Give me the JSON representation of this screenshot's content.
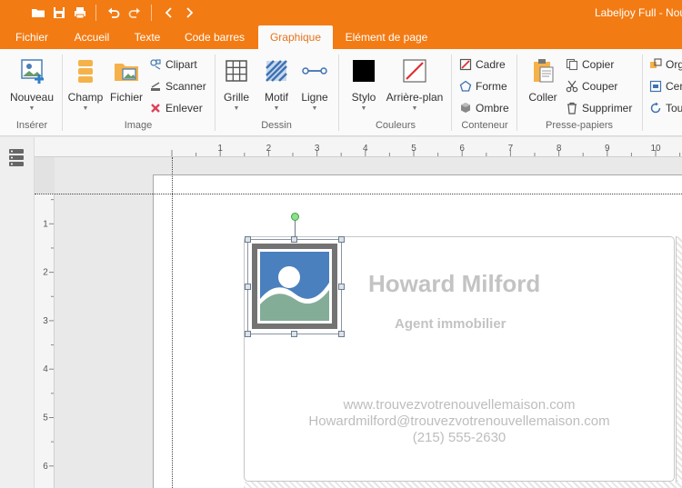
{
  "window": {
    "title": "Labeljoy Full - Nou"
  },
  "tabs": [
    {
      "label": "Fichier"
    },
    {
      "label": "Accueil"
    },
    {
      "label": "Texte"
    },
    {
      "label": "Code barres"
    },
    {
      "label": "Graphique"
    },
    {
      "label": "Elément de page"
    }
  ],
  "active_tab": "Graphique",
  "ribbon": {
    "inserer": {
      "nouveau": "Nouveau",
      "group_label": "Insérer"
    },
    "image": {
      "champ": "Champ",
      "fichier": "Fichier",
      "clipart": "Clipart",
      "scanner": "Scanner",
      "enlever": "Enlever",
      "group_label": "Image"
    },
    "dessin": {
      "grille": "Grille",
      "motif": "Motif",
      "ligne": "Ligne",
      "group_label": "Dessin"
    },
    "couleurs": {
      "stylo": "Stylo",
      "arriere_plan": "Arrière-plan",
      "group_label": "Couleurs"
    },
    "conteneur": {
      "cadre": "Cadre",
      "forme": "Forme",
      "ombre": "Ombre",
      "group_label": "Conteneur"
    },
    "presse_papiers": {
      "coller": "Coller",
      "copier": "Copier",
      "couper": "Couper",
      "supprimer": "Supprimer",
      "group_label": "Presse-papiers"
    },
    "partial": {
      "org": "Org",
      "cer": "Cer",
      "tou": "Tou"
    }
  },
  "rulers": {
    "horizontal": [
      "1",
      "2",
      "3",
      "4",
      "5",
      "6",
      "7",
      "8",
      "9",
      "10"
    ],
    "vertical": [
      "1",
      "2",
      "3",
      "4",
      "5",
      "6"
    ]
  },
  "label": {
    "name": "Howard Milford",
    "job": "Agent immobilier",
    "website": "www.trouvezvotrenouvellemaison.com",
    "email": "Howardmilford@trouvezvotrenouvellemaison.com",
    "phone": "(215) 555-2630"
  },
  "colors": {
    "accent": "#f37b13",
    "tab_active_text": "#e8731a",
    "label_text": "#c3c3c3"
  },
  "icons": {
    "open": "folder-icon",
    "save": "save-icon",
    "print": "print-icon",
    "undo": "undo-icon",
    "redo": "redo-icon",
    "back": "chevron-left-icon",
    "forward": "chevron-right-icon",
    "layers": "layers-icon"
  }
}
